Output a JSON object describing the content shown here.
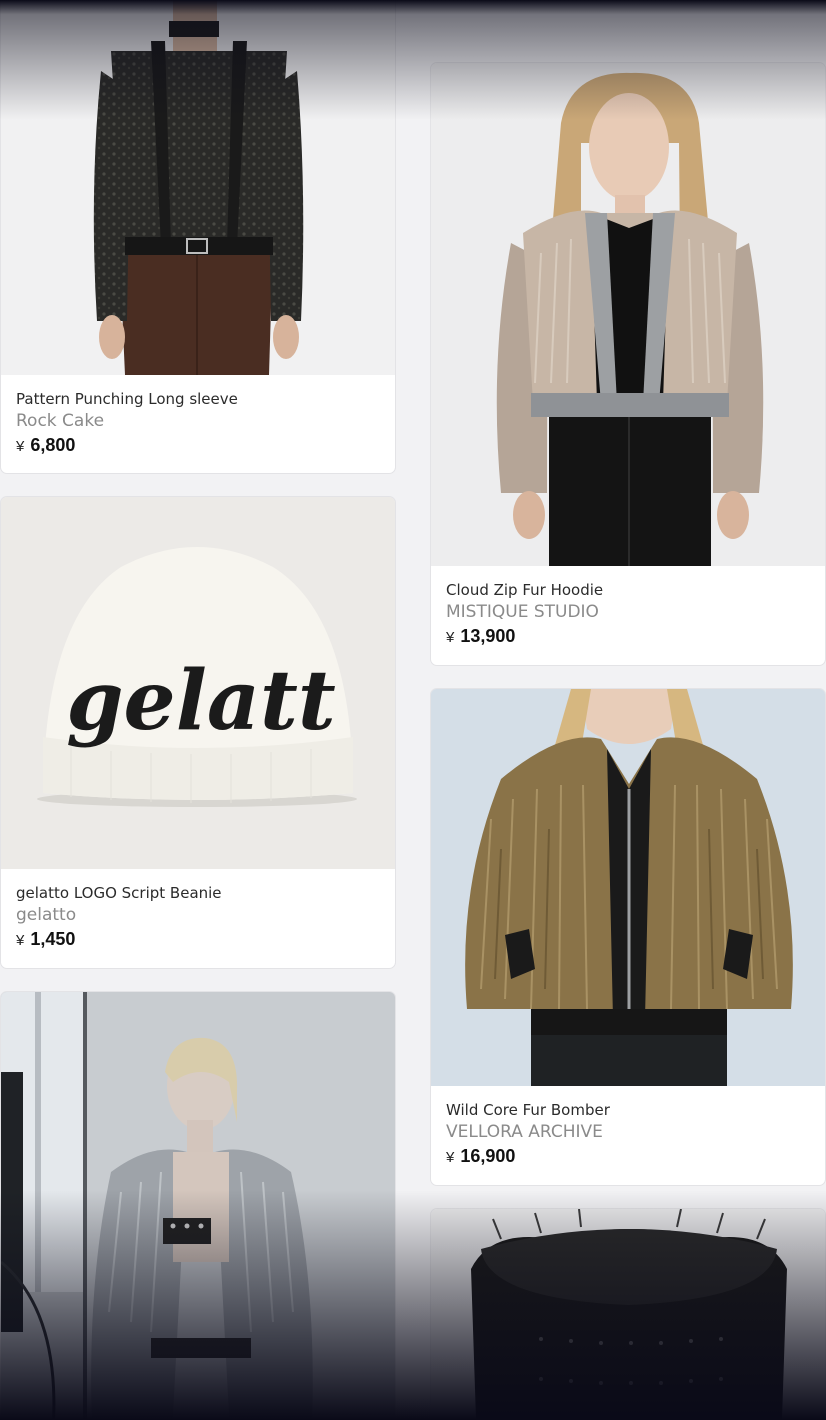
{
  "products": [
    {
      "id": "p1",
      "title": "Pattern Punching Long sleeve",
      "brand": "Rock Cake",
      "currency": "¥",
      "price": "6,800",
      "image": "woman-black-lace-top-icon"
    },
    {
      "id": "p2",
      "title": "Cloud Zip Fur Hoodie",
      "brand": "MISTIQUE STUDIO",
      "currency": "¥",
      "price": "13,900",
      "image": "woman-faux-fur-hoodie-icon"
    },
    {
      "id": "p3",
      "title": "gelatto LOGO Script Beanie",
      "brand": "gelatto",
      "currency": "¥",
      "price": "1,450",
      "image": "white-beanie-icon",
      "beanie_text": "gelatt"
    },
    {
      "id": "p4",
      "title": "Wild Core Fur Bomber",
      "brand": "VELLORA ARCHIVE",
      "currency": "¥",
      "price": "16,900",
      "image": "fur-bomber-jacket-icon"
    },
    {
      "id": "p5",
      "image": "model-grey-fur-coat-icon"
    },
    {
      "id": "p6",
      "image": "black-fur-top-icon"
    }
  ],
  "colors": {
    "page_bg": "#f2f2f4",
    "card_border": "#e3e3e6",
    "brand_text": "#8a8a8a",
    "overlay": "#0a0a18"
  }
}
